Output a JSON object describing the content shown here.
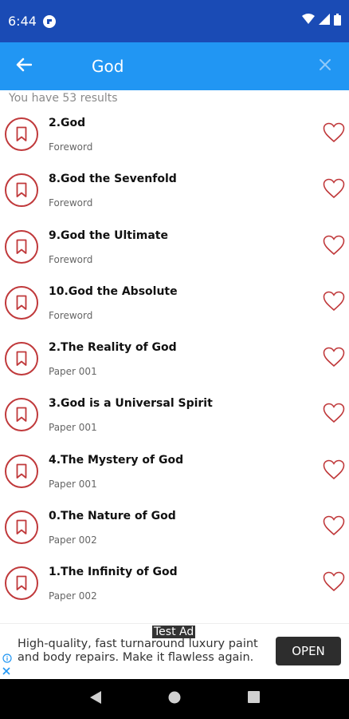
{
  "status_bar": {
    "time": "6:44"
  },
  "app_bar": {
    "search_query": "God"
  },
  "results": {
    "count_text": "You have 53 results",
    "items": [
      {
        "title": "2.God",
        "subtitle": "Foreword"
      },
      {
        "title": "8.God the Sevenfold",
        "subtitle": "Foreword"
      },
      {
        "title": "9.God the Ultimate",
        "subtitle": "Foreword"
      },
      {
        "title": "10.God the Absolute",
        "subtitle": "Foreword"
      },
      {
        "title": "2.The Reality of God",
        "subtitle": "Paper 001"
      },
      {
        "title": "3.God is a Universal Spirit",
        "subtitle": "Paper 001"
      },
      {
        "title": "4.The Mystery of God",
        "subtitle": "Paper 001"
      },
      {
        "title": "0.The Nature of God",
        "subtitle": "Paper 002"
      },
      {
        "title": "1.The Infinity of God",
        "subtitle": "Paper 002"
      }
    ]
  },
  "ad": {
    "label": "Test Ad",
    "text": "High-quality, fast turnaround luxury paint and body repairs. Make it flawless again.",
    "cta": "OPEN"
  },
  "colors": {
    "status_bar": "#1a4bb5",
    "app_bar": "#2196f3",
    "accent_red": "#c0393b"
  },
  "icons": {
    "back": "arrow-left-icon",
    "clear": "close-icon",
    "bookmark": "bookmark-icon",
    "favorite": "heart-outline-icon"
  }
}
